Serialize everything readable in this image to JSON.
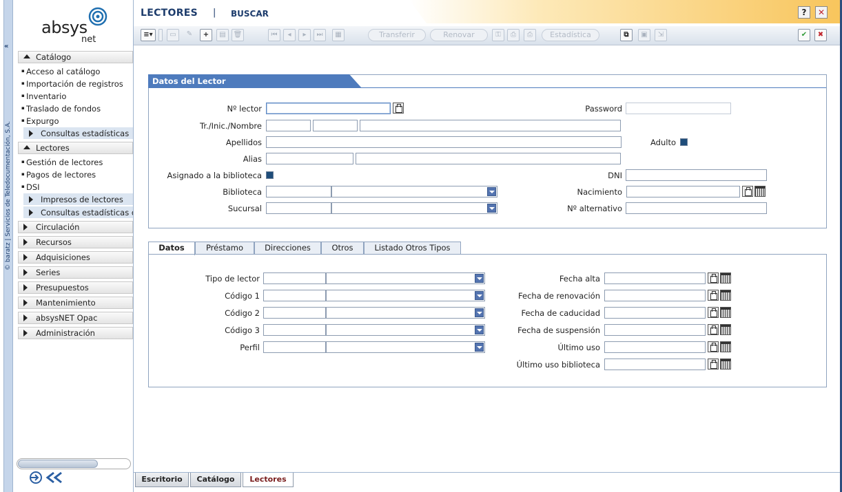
{
  "vertical_credit": "© baratz | Servicios de Teledocumentación, S.A.",
  "collapse_symbol": "«",
  "logo": {
    "main": "absys",
    "sub": "net"
  },
  "sidebar": {
    "catalogo": "Catálogo",
    "catalogo_items": [
      "Acceso al catálogo",
      "Importación de registros",
      "Inventario",
      "Traslado de fondos",
      "Expurgo"
    ],
    "catalogo_sub": "Consultas estadísticas",
    "lectores": "Lectores",
    "lectores_items": [
      "Gestión de lectores",
      "Pagos de lectores",
      "DSI"
    ],
    "lectores_sub": [
      "Impresos de lectores",
      "Consultas estadísticas de lectores"
    ],
    "sections": [
      "Circulación",
      "Recursos",
      "Adquisiciones",
      "Series",
      "Presupuestos",
      "Mantenimiento",
      "absysNET Opac",
      "Administración"
    ]
  },
  "header": {
    "title": "LECTORES",
    "separator": "|",
    "search": "BUSCAR",
    "help": "?",
    "close": "✕"
  },
  "toolbar": {
    "plus": "+",
    "transfer": "Transferir",
    "renew": "Renovar",
    "stats": "Estadística"
  },
  "panel": {
    "title": "Datos del Lector",
    "labels": {
      "num_lector": "Nº lector",
      "tr_nombre": "Tr./Inic./Nombre",
      "apellidos": "Apellidos",
      "alias": "Alias",
      "asignado": "Asignado a la biblioteca",
      "biblioteca": "Biblioteca",
      "sucursal": "Sucursal",
      "password": "Password",
      "adulto": "Adulto",
      "dni": "DNI",
      "nacimiento": "Nacimiento",
      "num_alternativo": "Nº alternativo"
    }
  },
  "tabs": [
    "Datos",
    "Préstamo",
    "Direcciones",
    "Otros",
    "Listado Otros Tipos"
  ],
  "datos": {
    "left_labels": [
      "Tipo de lector",
      "Código 1",
      "Código 2",
      "Código 3",
      "Perfil"
    ],
    "right_labels": [
      "Fecha alta",
      "Fecha de renovación",
      "Fecha de caducidad",
      "Fecha de suspensión",
      "Último uso",
      "Último uso biblioteca"
    ]
  },
  "bottom_tabs": [
    "Escritorio",
    "Catálogo",
    "Lectores"
  ]
}
